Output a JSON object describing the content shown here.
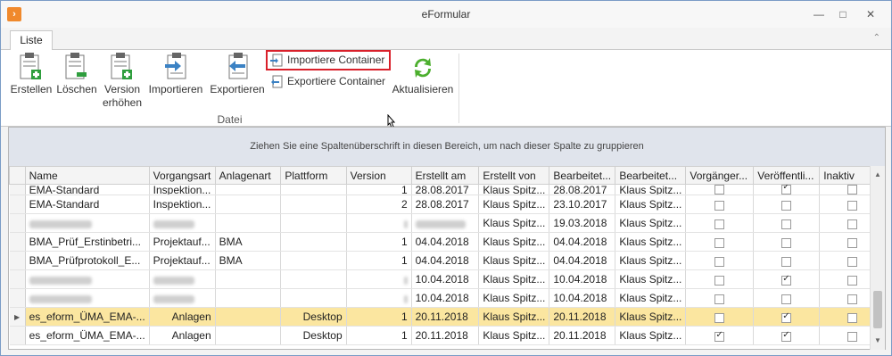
{
  "window": {
    "title": "eFormular"
  },
  "ribbon": {
    "tab": "Liste",
    "buttons": {
      "erstellen": "Erstellen",
      "loeschen": "Löschen",
      "version_1": "Version",
      "version_2": "erhöhen",
      "importieren": "Importieren",
      "exportieren": "Exportieren",
      "importiere_container": "Importiere Container",
      "exportiere_container": "Exportiere Container",
      "aktualisieren": "Aktualisieren"
    },
    "group_label": "Datei"
  },
  "grid": {
    "group_hint": "Ziehen Sie eine Spaltenüberschrift in diesen Bereich, um nach dieser Spalte zu gruppieren",
    "columns": [
      "Name",
      "Vorgangsart",
      "Anlagenart",
      "Plattform",
      "Version",
      "Erstellt am",
      "Erstellt von",
      "Bearbeitet...",
      "Bearbeitet...",
      "Vorgänger...",
      "Veröffentli...",
      "Inaktiv"
    ],
    "rows": [
      {
        "name": "EMA-Standard",
        "vorgangsart": "Inspektion...",
        "anlagenart": "",
        "plattform": "",
        "version": "1",
        "erstellt_am": "28.08.2017",
        "erstellt_von": "Klaus Spitz...",
        "bearbeitet_am": "28.08.2017",
        "bearbeitet_von": "Klaus Spitz...",
        "vorgaenger": false,
        "veroeffentlicht": true,
        "inaktiv": false
      },
      {
        "name": "EMA-Standard",
        "vorgangsart": "Inspektion...",
        "anlagenart": "",
        "plattform": "",
        "version": "2",
        "erstellt_am": "28.08.2017",
        "erstellt_von": "Klaus Spitz...",
        "bearbeitet_am": "23.10.2017",
        "bearbeitet_von": "Klaus Spitz...",
        "vorgaenger": false,
        "veroeffentlicht": false,
        "inaktiv": false
      },
      {
        "name": "",
        "vorgangsart": "",
        "anlagenart": "",
        "plattform": "",
        "version": "",
        "erstellt_am": "",
        "erstellt_von": "Klaus Spitz...",
        "bearbeitet_am": "19.03.2018",
        "bearbeitet_von": "Klaus Spitz...",
        "vorgaenger": false,
        "veroeffentlicht": false,
        "inaktiv": false
      },
      {
        "name": "BMA_Prüf_Erstinbetri...",
        "vorgangsart": "Projektauf...",
        "anlagenart": "BMA",
        "plattform": "",
        "version": "1",
        "erstellt_am": "04.04.2018",
        "erstellt_von": "Klaus Spitz...",
        "bearbeitet_am": "04.04.2018",
        "bearbeitet_von": "Klaus Spitz...",
        "vorgaenger": false,
        "veroeffentlicht": false,
        "inaktiv": false
      },
      {
        "name": "BMA_Prüfprotokoll_E...",
        "vorgangsart": "Projektauf...",
        "anlagenart": "BMA",
        "plattform": "",
        "version": "1",
        "erstellt_am": "04.04.2018",
        "erstellt_von": "Klaus Spitz...",
        "bearbeitet_am": "04.04.2018",
        "bearbeitet_von": "Klaus Spitz...",
        "vorgaenger": false,
        "veroeffentlicht": false,
        "inaktiv": false
      },
      {
        "name": "",
        "vorgangsart": "",
        "anlagenart": "",
        "plattform": "",
        "version": "",
        "erstellt_am": "10.04.2018",
        "erstellt_von": "Klaus Spitz...",
        "bearbeitet_am": "10.04.2018",
        "bearbeitet_von": "Klaus Spitz...",
        "vorgaenger": false,
        "veroeffentlicht": true,
        "inaktiv": false
      },
      {
        "name": "",
        "vorgangsart": "",
        "anlagenart": "",
        "plattform": "",
        "version": "",
        "erstellt_am": "10.04.2018",
        "erstellt_von": "Klaus Spitz...",
        "bearbeitet_am": "10.04.2018",
        "bearbeitet_von": "Klaus Spitz...",
        "vorgaenger": false,
        "veroeffentlicht": false,
        "inaktiv": false
      },
      {
        "name": "es_eform_ÜMA_EMA-...",
        "vorgangsart": "Anlagen",
        "anlagenart": "",
        "plattform": "Desktop",
        "version": "1",
        "erstellt_am": "20.11.2018",
        "erstellt_von": "Klaus Spitz...",
        "bearbeitet_am": "20.11.2018",
        "bearbeitet_von": "Klaus Spitz...",
        "vorgaenger": false,
        "veroeffentlicht": true,
        "inaktiv": false
      },
      {
        "name": "es_eform_ÜMA_EMA-...",
        "vorgangsart": "Anlagen",
        "anlagenart": "",
        "plattform": "Desktop",
        "version": "1",
        "erstellt_am": "20.11.2018",
        "erstellt_von": "Klaus Spitz...",
        "bearbeitet_am": "20.11.2018",
        "bearbeitet_von": "Klaus Spitz...",
        "vorgaenger": true,
        "veroeffentlicht": true,
        "inaktiv": false
      }
    ]
  }
}
